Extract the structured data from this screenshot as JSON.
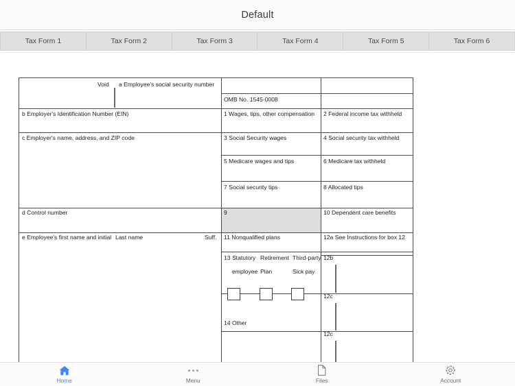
{
  "header": {
    "title": "Default"
  },
  "tabs": [
    {
      "label": "Tax Form 1"
    },
    {
      "label": "Tax Form 2"
    },
    {
      "label": "Tax Form 3"
    },
    {
      "label": "Tax Form 4"
    },
    {
      "label": "Tax Form 5"
    },
    {
      "label": "Tax Form 6"
    }
  ],
  "form": {
    "void_label": "Void",
    "box_a": "a  Employee's social security number",
    "omb": "OMB No. 1545-0008",
    "box_b": "b Employer's Identification Number (EIN)",
    "box_c": "c Employer's name, address, and ZIP code",
    "box_d": "d Control number",
    "box_e": "e Employee's first name and initial",
    "box_e_last": "Last name",
    "box_e_suffix": "Suff.",
    "box_1": "1  Wages, tips, other compensation",
    "box_2": "2 Federal income tax withheld",
    "box_3": "3  Social Security wages",
    "box_4": "4 Social security tax withheld",
    "box_5": "5  Medicare wages and tips",
    "box_6": "6 Medicare tax withheld",
    "box_7": "7  Social security tips",
    "box_8": "8 Allocated tips",
    "box_9": "9",
    "box_10": "10 Dependent care benefits",
    "box_11": "11 Nonqualified plans",
    "box_12a": "12a See Instructions for box 12",
    "box_12b": "12b",
    "box_12c": "12c",
    "box_12d": "12c",
    "box_13": "13 Statutory",
    "box_13_retirement": "Retirement",
    "box_13_thirdparty": "Third-party",
    "box_13_employee": "employee",
    "box_13_plan": "Plan",
    "box_13_sickpay": "Sick pay",
    "box_14": "14 Other"
  },
  "bottomnav": [
    {
      "label": "Home",
      "icon": "home-icon",
      "active": true
    },
    {
      "label": "Menu",
      "icon": "dots-icon",
      "active": false
    },
    {
      "label": "Files",
      "icon": "file-icon",
      "active": false
    },
    {
      "label": "Account",
      "icon": "gear-icon",
      "active": false
    }
  ],
  "colors": {
    "accent": "#4285f4",
    "tab_bg": "#e0e0e0",
    "shade": "#dedede"
  }
}
